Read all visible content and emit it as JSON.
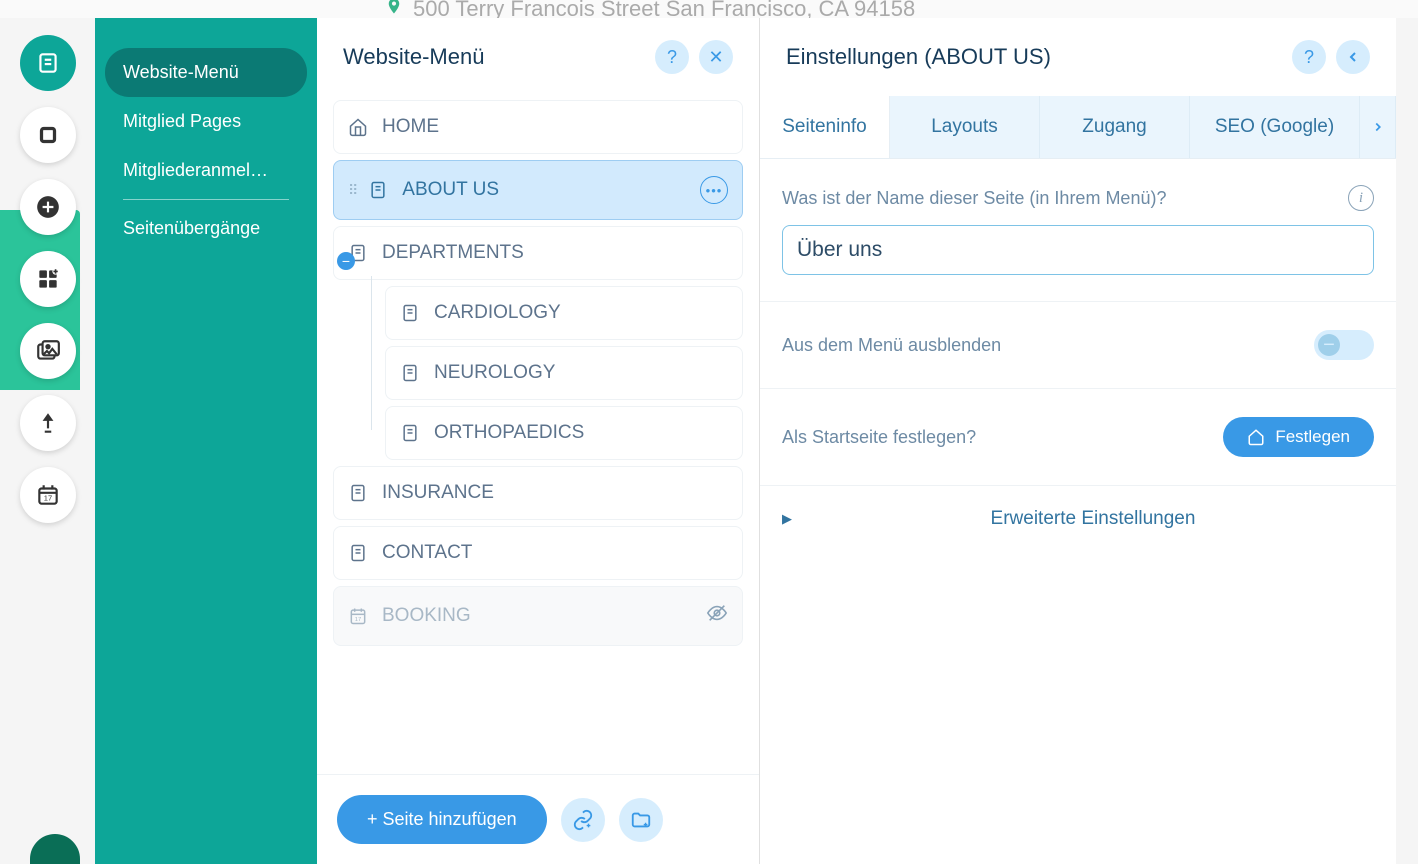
{
  "topAddress": "500 Terry Francois Street San Francisco, CA 94158",
  "tealMenu": {
    "items": [
      {
        "label": "Website-Menü",
        "active": true
      },
      {
        "label": "Mitglied Pages",
        "active": false
      },
      {
        "label": "Mitgliederanmel…",
        "active": false
      },
      {
        "label": "Seitenübergänge",
        "active": false
      }
    ]
  },
  "menuPanel": {
    "title": "Website-Menü",
    "items": [
      {
        "label": "HOME",
        "icon": "home"
      },
      {
        "label": "ABOUT US",
        "icon": "page",
        "selected": true
      },
      {
        "label": "DEPARTMENTS",
        "icon": "page",
        "children": [
          {
            "label": "CARDIOLOGY",
            "icon": "page"
          },
          {
            "label": "NEUROLOGY",
            "icon": "page"
          },
          {
            "label": "ORTHOPAEDICS",
            "icon": "page"
          }
        ]
      },
      {
        "label": "INSURANCE",
        "icon": "page"
      },
      {
        "label": "CONTACT",
        "icon": "page"
      },
      {
        "label": "BOOKING",
        "icon": "calendar",
        "faded": true,
        "hidden": true
      }
    ],
    "addPageLabel": "+ Seite hinzufügen"
  },
  "settings": {
    "title": "Einstellungen (ABOUT US)",
    "tabs": [
      "Seiteninfo",
      "Layouts",
      "Zugang",
      "SEO (Google)"
    ],
    "activeTab": 0,
    "nameField": {
      "label": "Was ist der Name dieser Seite (in Ihrem Menü)?",
      "value": "Über uns"
    },
    "hideLabel": "Aus dem Menü ausblenden",
    "homepageLabel": "Als Startseite festlegen?",
    "setHomeButton": "Festlegen",
    "advancedLabel": "Erweiterte Einstellungen"
  }
}
